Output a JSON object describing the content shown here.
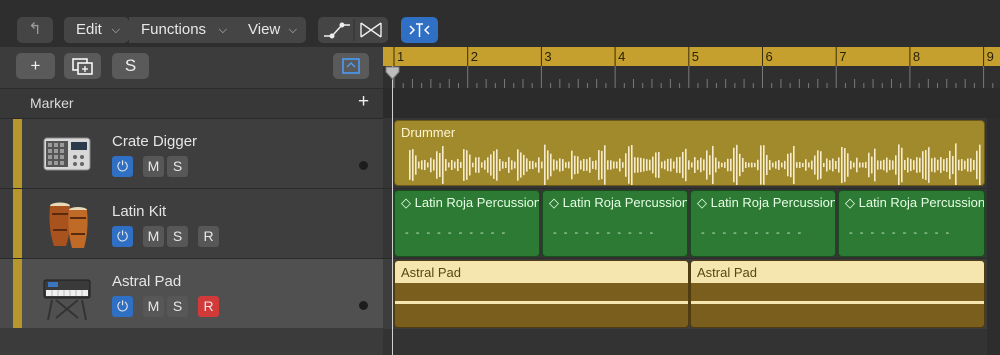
{
  "toolbar": {
    "edit_label": "Edit",
    "functions_label": "Functions",
    "view_label": "View"
  },
  "header_buttons": {
    "add": "+",
    "solo": "S"
  },
  "marker": {
    "label": "Marker",
    "add": "+"
  },
  "ruler": {
    "bars": [
      "1",
      "2",
      "3",
      "4",
      "5",
      "6",
      "7",
      "8",
      "9"
    ]
  },
  "tracks": [
    {
      "name": "Crate Digger",
      "buttons": [
        "M",
        "S"
      ],
      "icon": "drum-machine-icon"
    },
    {
      "name": "Latin Kit",
      "buttons": [
        "M",
        "S",
        "R"
      ],
      "icon": "congas-icon"
    },
    {
      "name": "Astral Pad",
      "buttons": [
        "M",
        "S",
        "R"
      ],
      "icon": "keyboard-icon"
    }
  ],
  "regions": {
    "drummer": {
      "title": "Drummer",
      "color": "#a08a2c"
    },
    "latin": [
      {
        "title": "◇ Latin Roja Percussion"
      },
      {
        "title": "◇ Latin Roja Percussion"
      },
      {
        "title": "◇ Latin Roja Percussion"
      },
      {
        "title": "◇ Latin Roja Percussion"
      }
    ],
    "astral": [
      {
        "title": "Astral Pad"
      },
      {
        "title": "Astral Pad"
      }
    ]
  },
  "colors": {
    "accent_blue": "#2f6fc4",
    "record_red": "#d23a3a",
    "ruler": "#c5a02e",
    "drummer": "#a08a2c",
    "latin": "#2c7a33",
    "astral_light": "#f5e6b0",
    "astral_dark": "#7a5e1e"
  }
}
